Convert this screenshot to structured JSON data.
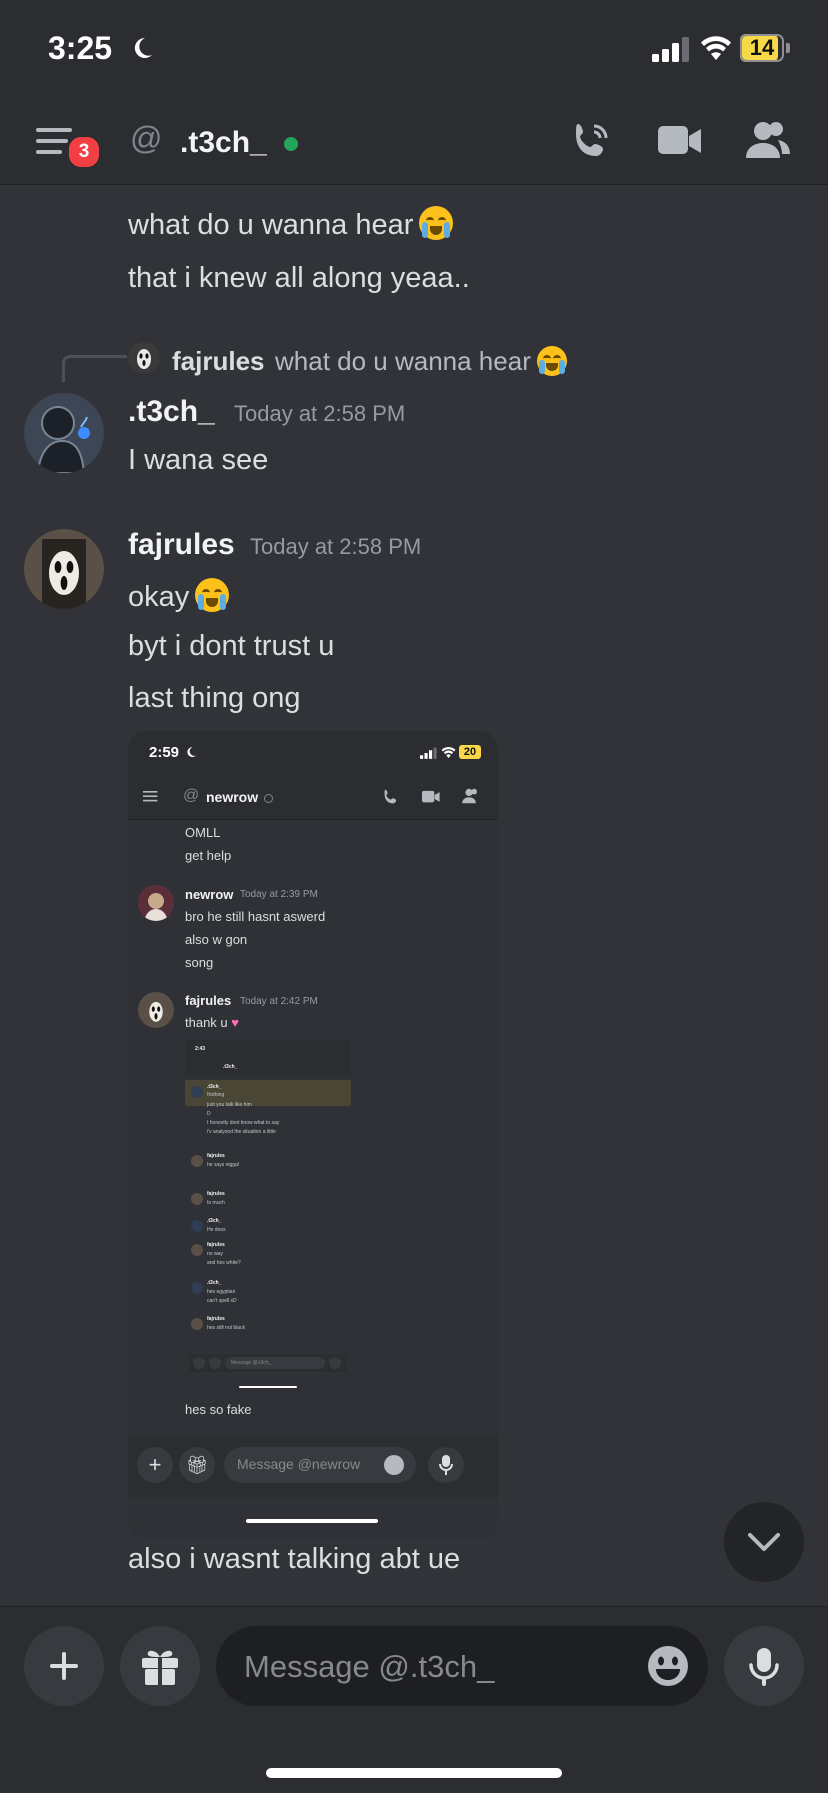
{
  "status_bar": {
    "time": "3:25",
    "battery": "14"
  },
  "header": {
    "menu_badge": "3",
    "channel_name": ".t3ch_"
  },
  "messages": {
    "top_lines": [
      "what do u wanna hear",
      "that i knew all along yeaa.."
    ],
    "reply": {
      "author": "fajrules",
      "text": "what do u wanna hear"
    },
    "t3ch": {
      "author": ".t3ch_",
      "timestamp": "Today at 2:58 PM",
      "lines": [
        "I wana see"
      ]
    },
    "fajrules": {
      "author": "fajrules",
      "timestamp": "Today at 2:58 PM",
      "lines": [
        "okay",
        "byt i dont trust u",
        "last thing ong"
      ]
    },
    "bottom_lines": [
      "also i wasnt talking abt ue"
    ]
  },
  "attachment": {
    "status_time": "2:59",
    "battery": "20",
    "channel_name": "newrow",
    "top_lines": [
      "OMLL",
      "get help"
    ],
    "newrow": {
      "author": "newrow",
      "timestamp": "Today at 2:39 PM",
      "lines": [
        "bro he still hasnt aswerd",
        "also w gon",
        "song"
      ]
    },
    "fajrules": {
      "author": "fajrules",
      "timestamp": "Today at 2:42 PM",
      "lines": [
        "thank u"
      ]
    },
    "after_image": "hes so fake",
    "composer_placeholder": "Message @newrow",
    "nested": {
      "time": "2:43",
      "channel_name": ".t3ch_",
      "items": [
        {
          "author": ".t3ch_",
          "lines": [
            "Nothing",
            "just you talk like him",
            "D",
            "I honestly dont know what to say",
            "i'v analyzed the situation a little"
          ]
        },
        {
          "author": "fajrules",
          "lines": [
            "he says nigga!"
          ]
        },
        {
          "author": "fajrules",
          "lines": [
            "to much"
          ]
        },
        {
          "author": ".t3ch_",
          "lines": [
            "He does"
          ]
        },
        {
          "author": "fajrules",
          "lines": [
            "no way",
            "and hes white?"
          ]
        },
        {
          "author": ".t3ch_",
          "lines": [
            "hes egyptian",
            "can't spell xD"
          ]
        },
        {
          "author": "fajrules",
          "lines": [
            "hes still not black"
          ]
        }
      ],
      "composer_placeholder": "Message @.t3ch_"
    }
  },
  "composer": {
    "placeholder": "Message @.t3ch_"
  },
  "colors": {
    "background": "#313338",
    "header": "#2b2d31",
    "online": "#23a55a",
    "badge": "#f23f43"
  }
}
